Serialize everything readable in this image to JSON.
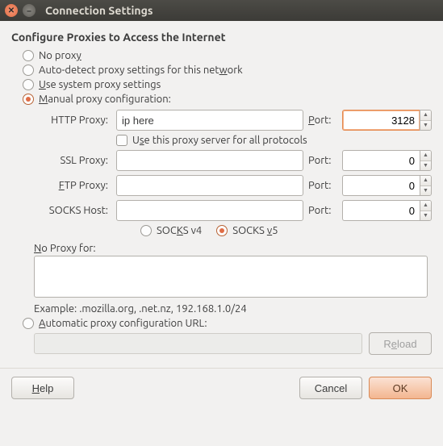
{
  "window": {
    "title": "Connection Settings"
  },
  "heading": "Configure Proxies to Access the Internet",
  "radios": {
    "no_proxy": "No proxy",
    "auto_detect_pre": "Auto-detect proxy settings for this net",
    "auto_detect_u": "w",
    "auto_detect_post": "ork",
    "use_system_u": "U",
    "use_system_post": "se system proxy settings",
    "manual_u": "M",
    "manual_post": "anual proxy configuration:",
    "auto_cfg_u": "A",
    "auto_cfg_post": "utomatic proxy configuration URL:"
  },
  "fields": {
    "http_label": "HTTP Proxy:",
    "ssl_label": "SSL Proxy:",
    "ftp_label_u": "F",
    "ftp_label_post": "TP Proxy:",
    "socks_label": "SOCKS Host:",
    "port_label_u": "P",
    "port_label_post": "ort:",
    "port_label_plain": "Port:",
    "http_value": "ip here",
    "ssl_value": "",
    "ftp_value": "",
    "socks_value": "",
    "http_port": "3128",
    "ssl_port": "0",
    "ftp_port": "0",
    "socks_port": "0"
  },
  "use_all_pre": "U",
  "use_all_u": "s",
  "use_all_post": "e this proxy server for all protocols",
  "socks": {
    "v4_pre": "SOC",
    "v4_u": "K",
    "v4_post": "S v4",
    "v5_pre": "SOCKS ",
    "v5_u": "v",
    "v5_post": "5"
  },
  "noproxy": {
    "label_u": "N",
    "label_post": "o Proxy for:",
    "value": "",
    "example": "Example: .mozilla.org, .net.nz, 192.168.1.0/24"
  },
  "buttons": {
    "reload_pre": "R",
    "reload_u": "e",
    "reload_post": "load",
    "help_u": "H",
    "help_post": "elp",
    "cancel": "Cancel",
    "ok": "OK"
  }
}
